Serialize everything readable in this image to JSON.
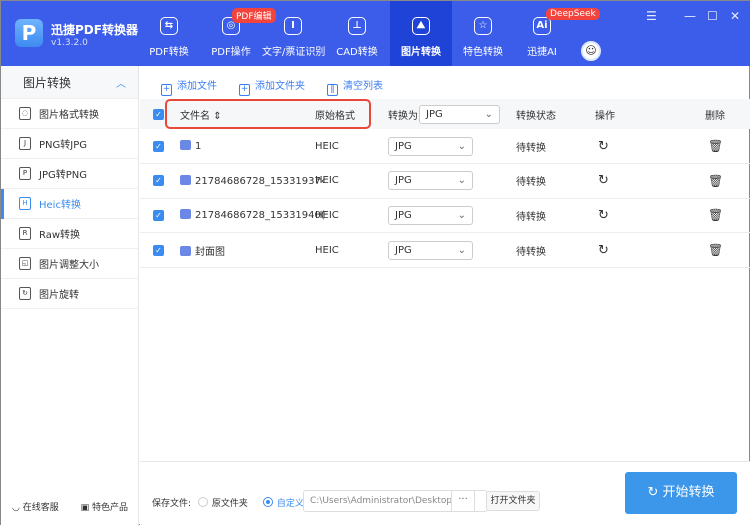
{
  "app": {
    "name": "迅捷PDF转换器",
    "version": "v1.3.2.0",
    "logo_letter": "P"
  },
  "nav": [
    {
      "label": "PDF转换",
      "icon": "pdf-convert-icon",
      "glyph": "⇆"
    },
    {
      "label": "PDF操作",
      "icon": "pdf-operate-icon",
      "glyph": "◎",
      "badge": "PDF编辑"
    },
    {
      "label": "文字/票证识别",
      "icon": "ocr-icon",
      "glyph": "I"
    },
    {
      "label": "CAD转换",
      "icon": "cad-icon",
      "glyph": "⊥"
    },
    {
      "label": "图片转换",
      "icon": "image-icon",
      "glyph": "⛰",
      "active": true
    },
    {
      "label": "特色转换",
      "icon": "star-convert-icon",
      "glyph": "☆"
    },
    {
      "label": "迅捷AI",
      "icon": "ai-icon",
      "glyph": "Ai",
      "badge": "DeepSeek"
    }
  ],
  "window": {
    "menu": "☰",
    "minimize": "—",
    "maximize": "☐",
    "close": "✕"
  },
  "sidebar": {
    "header": "图片转换",
    "items": [
      {
        "label": "图片格式转换",
        "glyph": "◌"
      },
      {
        "label": "PNG转JPG",
        "glyph": "J"
      },
      {
        "label": "JPG转PNG",
        "glyph": "P"
      },
      {
        "label": "Heic转换",
        "glyph": "H",
        "active": true
      },
      {
        "label": "Raw转换",
        "glyph": "R"
      },
      {
        "label": "图片调整大小",
        "glyph": "◱"
      },
      {
        "label": "图片旋转",
        "glyph": "↻"
      }
    ],
    "footer": {
      "service": "在线客服",
      "products": "特色产品"
    }
  },
  "toolbar": {
    "add_file": "添加文件",
    "add_folder": "添加文件夹",
    "clear_list": "清空列表"
  },
  "table": {
    "headers": {
      "name": "文件名",
      "format": "原始格式",
      "convert_to": "转换为",
      "convert_to_value": "JPG",
      "status": "转换状态",
      "operation": "操作",
      "delete": "删除"
    },
    "rows": [
      {
        "name": "1",
        "format": "HEIC",
        "target": "JPG",
        "status": "待转换"
      },
      {
        "name": "21784686728_15331937‹",
        "format": "HEIC",
        "target": "JPG",
        "status": "待转换"
      },
      {
        "name": "21784686728_15331940(",
        "format": "HEIC",
        "target": "JPG",
        "status": "待转换"
      },
      {
        "name": "封面图",
        "format": "HEIC",
        "target": "JPG",
        "status": "待转换"
      }
    ]
  },
  "bottom": {
    "save_label": "保存文件:",
    "original_folder": "原文件夹",
    "custom": "自定义",
    "path": "C:\\Users\\Administrator\\Desktop",
    "browse": "···",
    "open_folder": "打开文件夹",
    "start": "开始转换"
  },
  "colors": {
    "topbar": "#3b5de9",
    "accent": "#3b8cf0",
    "highlight_box": "#e8473a",
    "start_button": "#3c96ea"
  }
}
